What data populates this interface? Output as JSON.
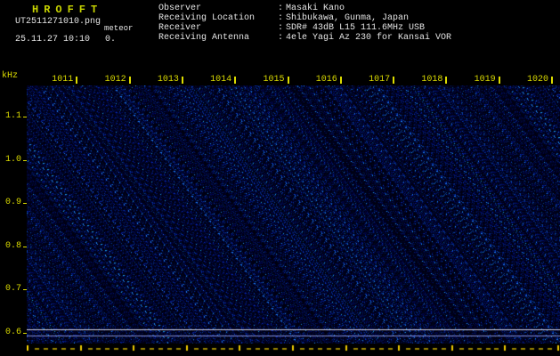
{
  "colors": {
    "background": "#000000",
    "accent_yellow": "#dcdc00",
    "title_yellow_green": "#c8d400",
    "text_white": "#e4e4e4",
    "noise_dark_blue": "#000a2e",
    "noise_bright_cyan": "#58b0ff",
    "level_line_white": "#d2d2e1",
    "level_line_blue": "#828cd2",
    "ruler_major": "#f0cc00",
    "ruler_minor": "#9a8400"
  },
  "app": {
    "title": "HROFFT"
  },
  "file_info": {
    "filename": "UT2511271010.png",
    "mode": "meteor",
    "datetime": "25.11.27 10:10",
    "counter": "0."
  },
  "header": {
    "separator": ":",
    "rows": [
      {
        "label": "Observer",
        "value": "Masaki Kano"
      },
      {
        "label": "Receiving Location",
        "value": "Shibukawa, Gunma, Japan"
      },
      {
        "label": "Receiver",
        "value": "SDR# 43dB L15 111.6MHz USB"
      },
      {
        "label": "Receiving Antenna",
        "value": "4ele Yagi Az 230 for Kansai VOR"
      }
    ]
  },
  "spectrogram": {
    "y_axis_unit": "kHz",
    "y_tick_labels": [
      "1.1",
      "1.0",
      "0.9",
      "0.8",
      "0.7",
      "0.6"
    ],
    "x_tick_labels": [
      "1011",
      "1012",
      "1013",
      "1014",
      "1015",
      "1016",
      "1017",
      "1018",
      "1019",
      "1020"
    ]
  }
}
